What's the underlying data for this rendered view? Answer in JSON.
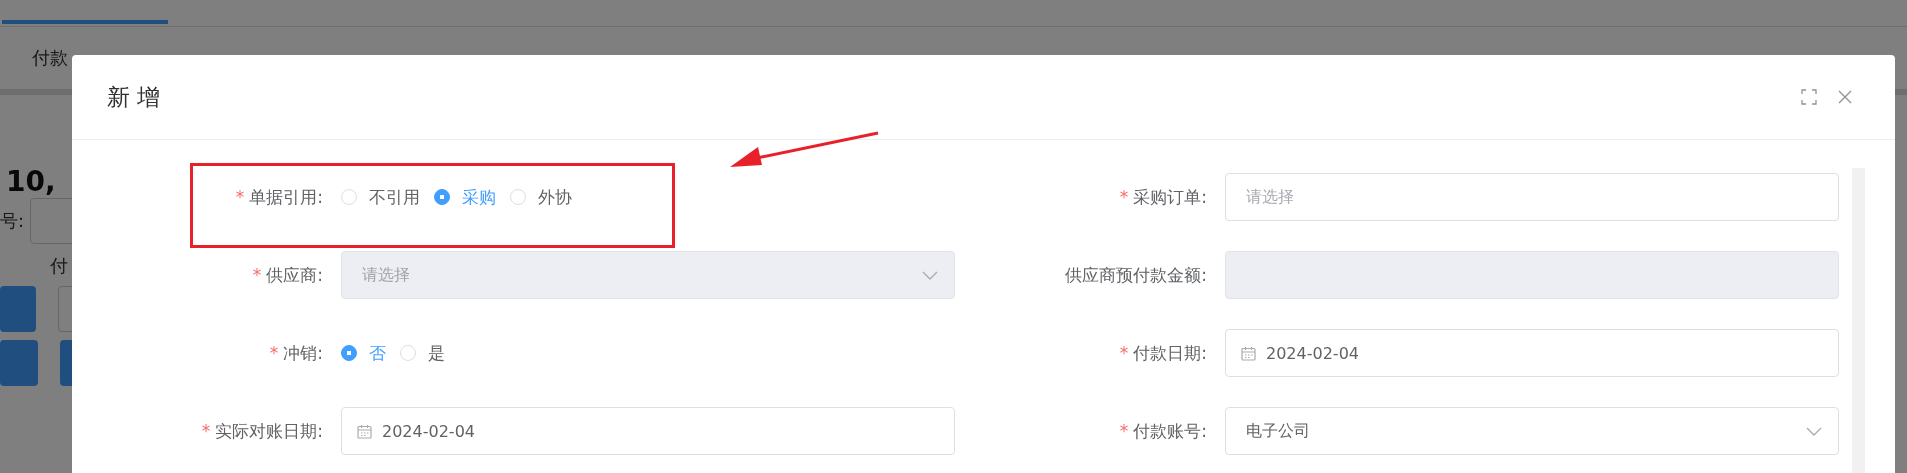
{
  "background": {
    "tab_label": "付款",
    "total_fragment": "10,",
    "field_label_fragment": "号:",
    "field_label_fragment_2": "付"
  },
  "dialog": {
    "title": "新 增",
    "fields": [
      {
        "kind": "radio",
        "label": "单据引用:",
        "required_mark": "*",
        "highlighted": true,
        "options": [
          {
            "label": "不引用",
            "selected": false
          },
          {
            "label": "采购",
            "selected": true
          },
          {
            "label": "外协",
            "selected": false
          }
        ]
      },
      {
        "kind": "input",
        "label": "采购订单:",
        "required_mark": "*",
        "placeholder": "请选择",
        "disabled": false
      },
      {
        "kind": "select",
        "label": "供应商:",
        "required_mark": "*",
        "placeholder": "请选择",
        "disabled": true
      },
      {
        "kind": "input",
        "label": "供应商预付款金额:",
        "disabled": true
      },
      {
        "kind": "radio",
        "label": "冲销:",
        "required_mark": "*",
        "options": [
          {
            "label": "否",
            "selected": true
          },
          {
            "label": "是",
            "selected": false
          }
        ]
      },
      {
        "kind": "date",
        "label": "付款日期:",
        "required_mark": "*",
        "value": "2024-02-04",
        "disabled": false
      },
      {
        "kind": "date",
        "label": "实际对账日期:",
        "required_mark": "*",
        "value": "2024-02-04",
        "disabled": false
      },
      {
        "kind": "select",
        "label": "付款账号:",
        "required_mark": "*",
        "value": "电子公司",
        "disabled": false
      }
    ]
  }
}
